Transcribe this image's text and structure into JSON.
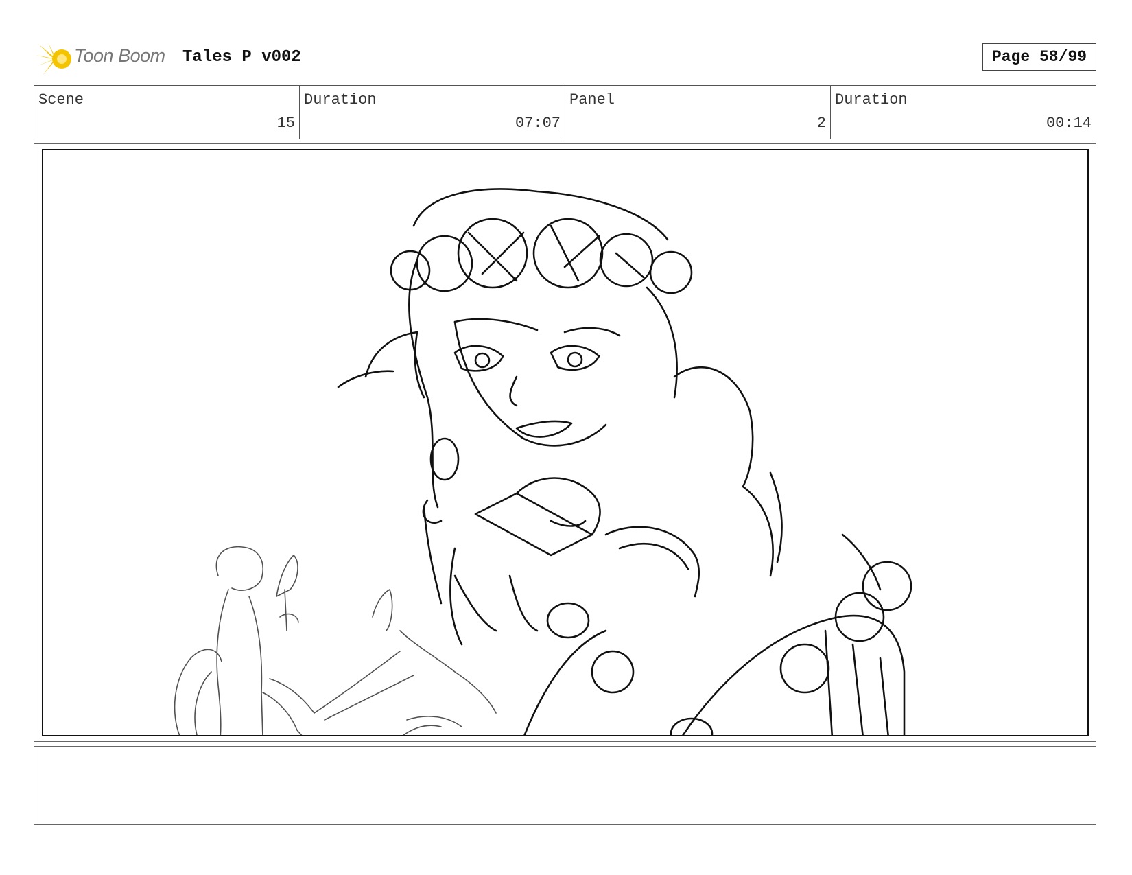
{
  "header": {
    "logo_text": "Toon Boom",
    "title": "Tales P v002",
    "page": "Page 58/99",
    "accent_color": "#f5c400"
  },
  "info": {
    "scene_label": "Scene",
    "scene_value": "15",
    "scene_duration_label": "Duration",
    "scene_duration_value": "07:07",
    "panel_label": "Panel",
    "panel_value": "2",
    "panel_duration_label": "Duration",
    "panel_duration_value": "00:14"
  },
  "notes": {
    "text": ""
  }
}
